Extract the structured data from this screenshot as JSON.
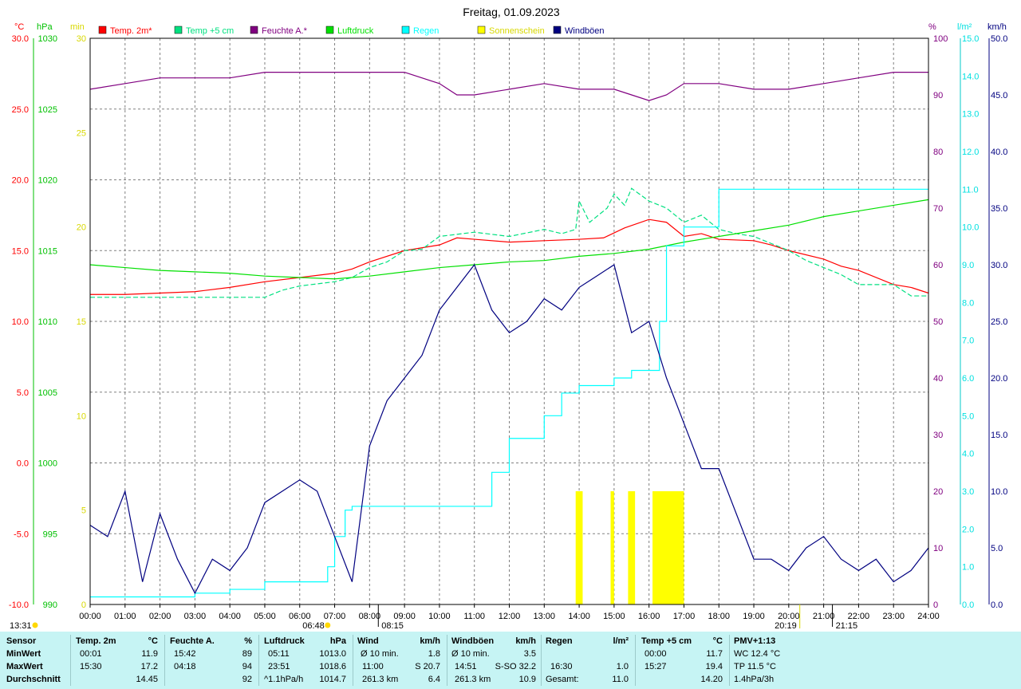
{
  "title": "Freitag, 01.09.2023",
  "axes": {
    "left1": {
      "unit": "°C",
      "color": "#ff0000",
      "ticks": [
        "30.0",
        "25.0",
        "20.0",
        "15.0",
        "10.0",
        "5.0",
        "0.0",
        "-5.0",
        "-10.0"
      ]
    },
    "left2": {
      "unit": "hPa",
      "color": "#00c000",
      "ticks": [
        "1030",
        "1025",
        "1020",
        "1015",
        "1010",
        "1005",
        "1000",
        "995",
        "990"
      ]
    },
    "left3": {
      "unit": "min",
      "color": "#ffff00",
      "ticks": [
        "30",
        "25",
        "20",
        "15",
        "10",
        "5",
        "0"
      ]
    },
    "right1": {
      "unit": "%",
      "color": "#800080",
      "ticks": [
        "100",
        "90",
        "80",
        "70",
        "60",
        "50",
        "40",
        "30",
        "20",
        "10",
        "0"
      ]
    },
    "right2": {
      "unit": "l/m²",
      "color": "#00e0e0",
      "ticks": [
        "15.0",
        "14.0",
        "13.0",
        "12.0",
        "11.0",
        "10.0",
        "9.0",
        "8.0",
        "7.0",
        "6.0",
        "5.0",
        "4.0",
        "3.0",
        "2.0",
        "1.0",
        "0.0"
      ]
    },
    "right3": {
      "unit": "km/h",
      "color": "#000080",
      "ticks": [
        "50.0",
        "45.0",
        "40.0",
        "35.0",
        "30.0",
        "25.0",
        "20.0",
        "15.0",
        "10.0",
        "5.0",
        "0.0"
      ]
    },
    "x_ticks": [
      "00:00",
      "01:00",
      "02:00",
      "03:00",
      "04:00",
      "05:00",
      "06:00",
      "07:00",
      "08:00",
      "09:00",
      "10:00",
      "11:00",
      "12:00",
      "13:00",
      "14:00",
      "15:00",
      "16:00",
      "17:00",
      "18:00",
      "19:00",
      "20:00",
      "21:00",
      "22:00",
      "23:00",
      "24:00"
    ]
  },
  "sun_markers": {
    "now": "13:31",
    "sunrise": "06:48",
    "sunset": "20:19",
    "moonset": "08:15",
    "moonrise": "21:15"
  },
  "colors": {
    "temp2m": "#ff0000",
    "temp5cm": "#00e080",
    "humidity": "#800080",
    "pressure": "#00e000",
    "rain": "#00ffff",
    "sunshine": "#ffff00",
    "gusts": "#000080",
    "grid": "#808080",
    "stats_bg": "#c6f4f4"
  },
  "chart_data": {
    "type": "line",
    "x_range": [
      0,
      24
    ],
    "series": [
      {
        "name": "Temp. 2m*",
        "axis": "°C",
        "x": [
          0,
          1,
          2,
          3,
          4,
          5,
          6,
          7,
          7.5,
          8,
          9,
          10,
          10.5,
          11,
          12,
          13,
          14,
          14.7,
          15.3,
          16,
          16.5,
          17,
          17.5,
          18,
          19,
          19.5,
          20,
          21,
          21.5,
          22,
          23,
          23.5,
          24
        ],
        "y": [
          11.9,
          11.9,
          12.0,
          12.1,
          12.4,
          12.8,
          13.1,
          13.4,
          13.7,
          14.2,
          15.0,
          15.4,
          15.9,
          15.8,
          15.6,
          15.7,
          15.8,
          15.9,
          16.6,
          17.2,
          17.0,
          16.0,
          16.2,
          15.8,
          15.7,
          15.4,
          15.0,
          14.4,
          13.9,
          13.6,
          12.6,
          12.4,
          12.0
        ]
      },
      {
        "name": "Temp +5 cm",
        "axis": "°C",
        "x": [
          0,
          1,
          2,
          3,
          4,
          5,
          5.5,
          6,
          7,
          7.5,
          8,
          8.5,
          9,
          9.5,
          10,
          11,
          12,
          13,
          13.5,
          13.9,
          14,
          14.3,
          14.8,
          15.0,
          15.3,
          15.5,
          16,
          16.5,
          17,
          17.5,
          18,
          18.5,
          19,
          19.5,
          20,
          20.5,
          21,
          21.5,
          22,
          23,
          23.5,
          24
        ],
        "y": [
          11.7,
          11.7,
          11.7,
          11.7,
          11.7,
          11.7,
          12.2,
          12.5,
          12.8,
          13.1,
          13.8,
          14.2,
          15.0,
          15.1,
          16.0,
          16.3,
          16.0,
          16.5,
          16.2,
          16.5,
          18.5,
          17.0,
          18.0,
          19.0,
          18.2,
          19.4,
          18.5,
          18.0,
          17.0,
          17.5,
          16.5,
          16.2,
          16.0,
          15.5,
          15.0,
          14.3,
          13.8,
          13.3,
          12.6,
          12.6,
          11.8,
          11.8
        ]
      },
      {
        "name": "Feuchte A.*",
        "axis": "%",
        "x": [
          0,
          1,
          2,
          3,
          4,
          5,
          6,
          7,
          8,
          9,
          10,
          10.5,
          11,
          12,
          13,
          14,
          15,
          15.5,
          16,
          16.5,
          17,
          18,
          19,
          20,
          21,
          22,
          23,
          24
        ],
        "y": [
          91,
          92,
          93,
          93,
          93,
          94,
          94,
          94,
          94,
          94,
          92,
          90,
          90,
          91,
          92,
          91,
          91,
          90,
          89,
          90,
          92,
          92,
          91,
          91,
          92,
          93,
          94,
          94
        ]
      },
      {
        "name": "Luftdruck",
        "axis": "hPa",
        "x": [
          0,
          1,
          2,
          3,
          4,
          5,
          6,
          7,
          8,
          9,
          10,
          11,
          12,
          13,
          14,
          15,
          16,
          17,
          18,
          19,
          20,
          21,
          22,
          23,
          24
        ],
        "y": [
          1014.0,
          1013.8,
          1013.6,
          1013.5,
          1013.4,
          1013.2,
          1013.1,
          1013.0,
          1013.2,
          1013.5,
          1013.8,
          1014.0,
          1014.2,
          1014.3,
          1014.6,
          1014.8,
          1015.1,
          1015.6,
          1016.0,
          1016.4,
          1016.8,
          1017.4,
          1017.8,
          1018.2,
          1018.6
        ]
      },
      {
        "name": "Regen",
        "axis": "l/m²",
        "x": [
          0,
          1,
          2,
          3,
          4,
          5,
          6,
          6.8,
          7,
          7.3,
          7.5,
          8,
          9,
          10,
          11,
          11.5,
          12,
          13,
          13.5,
          14,
          15,
          15.5,
          16,
          16.3,
          16.5,
          17,
          18,
          19,
          20,
          21,
          22,
          23,
          24
        ],
        "y": [
          0.2,
          0.2,
          0.2,
          0.3,
          0.4,
          0.6,
          0.6,
          1.0,
          1.8,
          2.5,
          2.6,
          2.6,
          2.6,
          2.6,
          2.6,
          3.5,
          4.4,
          5.0,
          5.6,
          5.8,
          6.0,
          6.2,
          6.2,
          7.5,
          9.5,
          10.0,
          11.0,
          11.0,
          11.0,
          11.0,
          11.0,
          11.0,
          11.0
        ]
      },
      {
        "name": "Sonnenschein",
        "axis": "min",
        "x": [
          13.9,
          14.1,
          14.9,
          15.0,
          15.4,
          15.6,
          16.1,
          17.0
        ],
        "y": [
          6,
          6,
          6,
          6,
          6,
          6,
          6,
          6
        ]
      },
      {
        "name": "Windböen",
        "axis": "km/h",
        "x": [
          0,
          0.5,
          1,
          1.5,
          2,
          2.5,
          3,
          3.5,
          4,
          4.5,
          5,
          5.5,
          6,
          6.5,
          7,
          7.5,
          8,
          8.5,
          9,
          9.5,
          10,
          10.5,
          11,
          11.5,
          12,
          12.5,
          13,
          13.5,
          14,
          14.5,
          15,
          15.5,
          16,
          16.5,
          17,
          17.5,
          18,
          18.5,
          19,
          19.5,
          20,
          20.5,
          21,
          21.5,
          22,
          22.5,
          23,
          23.5,
          24
        ],
        "y": [
          7,
          6,
          10,
          2,
          8,
          4,
          1,
          4,
          3,
          5,
          9,
          10,
          11,
          10,
          6,
          2,
          14,
          18,
          20,
          22,
          26,
          28,
          30,
          26,
          24,
          25,
          27,
          26,
          28,
          29,
          30,
          24,
          25,
          20,
          16,
          12,
          12,
          8,
          4,
          4,
          3,
          5,
          6,
          4,
          3,
          4,
          2,
          3,
          5
        ]
      }
    ]
  },
  "legend": [
    {
      "label": "Temp. 2m*",
      "color": "#ff0000"
    },
    {
      "label": "Temp +5 cm",
      "color": "#00e080"
    },
    {
      "label": "Feuchte A.*",
      "color": "#800080"
    },
    {
      "label": "Luftdruck",
      "color": "#00e000"
    },
    {
      "label": "Regen",
      "color": "#00ffff"
    },
    {
      "label": "Sonnenschein",
      "color": "#ffff00"
    },
    {
      "label": "Windböen",
      "color": "#000080"
    }
  ],
  "stats": {
    "row_labels": [
      "Sensor",
      "MinWert",
      "MaxWert",
      "Durchschnitt"
    ],
    "temp2m": {
      "title": "Temp. 2m",
      "unit": "°C",
      "min_time": "00:01",
      "min": "11.9",
      "max_time": "15:30",
      "max": "17.2",
      "avg": "14.45"
    },
    "humidity": {
      "title": "Feuchte A.",
      "unit": "%",
      "min_time": "15:42",
      "min": "89",
      "max_time": "04:18",
      "max": "94",
      "avg": "92"
    },
    "pressure": {
      "title": "Luftdruck",
      "unit": "hPa",
      "min_time": "05:11",
      "min": "1013.0",
      "max_time": "23:51",
      "max": "1018.6",
      "trend": "^1.1hPa/h",
      "avg": "1014.7"
    },
    "wind": {
      "title": "Wind",
      "unit": "km/h",
      "min_label": "Ø 10 min.",
      "min": "1.8",
      "max_time": "11:00",
      "max": "S 20.7",
      "dist": "261.3 km",
      "avg": "6.4"
    },
    "gusts": {
      "title": "Windböen",
      "unit": "km/h",
      "min_label": "Ø 10 min.",
      "min": "3.5",
      "max_time": "14:51",
      "max": "S-SO 32.2",
      "dist": "261.3 km",
      "avg": "10.9"
    },
    "rain": {
      "title": "Regen",
      "unit": "l/m²",
      "max_time": "16:30",
      "max": "1.0",
      "total_label": "Gesamt:",
      "total": "11.0"
    },
    "temp5cm": {
      "title": "Temp +5 cm",
      "unit": "°C",
      "min_time": "00:00",
      "min": "11.7",
      "max_time": "15:27",
      "max": "19.4",
      "avg": "14.20"
    },
    "pmv": {
      "title": "PMV+1:13",
      "wc": "WC 12.4 °C",
      "tp": "TP 11.5 °C",
      "trend": "1.4hPa/3h"
    }
  }
}
